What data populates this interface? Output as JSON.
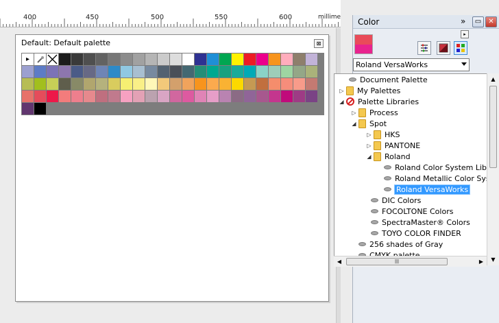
{
  "ruler": {
    "labels": [
      "400",
      "450",
      "500",
      "550",
      "600"
    ],
    "unit": "millimeters"
  },
  "palette_window": {
    "title": "Default: Default palette",
    "close_label": "⊠",
    "special_swatches": [
      "▸",
      "eyedropper",
      "none"
    ],
    "colors": [
      "#1c1c1c",
      "#3a3a3a",
      "#4f4f4f",
      "#626262",
      "#777777",
      "#8c8c8c",
      "#a1a1a1",
      "#b5b5b5",
      "#cbcbcb",
      "#dddddd",
      "#ffffff",
      "#2e3192",
      "#1f8fd6",
      "#00a651",
      "#fff200",
      "#ed1c24",
      "#ec008c",
      "#f7941d",
      "#ffadbc",
      "#8e7f6c",
      "#c2b3d8",
      "#9ca0d0",
      "#5d7cc6",
      "#7c73b7",
      "#8d76ae",
      "#4b5b87",
      "#676985",
      "#6f85b5",
      "#2d8ac8",
      "#90c8e2",
      "#a8bfd1",
      "#778aa0",
      "#536271",
      "#4a4f58",
      "#446872",
      "#248e77",
      "#00a890",
      "#17a17f",
      "#19ab9a",
      "#00aab6",
      "#8ad3c7",
      "#9ecdb8",
      "#9ed5a2",
      "#94a787",
      "#aab27a",
      "#b7bd55",
      "#a2bf1e",
      "#c7cf57",
      "#5f5e4c",
      "#888a67",
      "#b1a66e",
      "#b5b27d",
      "#d9cc5e",
      "#f6ef72",
      "#f9ef87",
      "#fff7b8",
      "#f3c97a",
      "#d3a06c",
      "#f0a35c",
      "#f7941d",
      "#fbaa4e",
      "#f9b233",
      "#fcd900",
      "#c59a53",
      "#c16f3e",
      "#f58d6c",
      "#f68d7b",
      "#f89b8a",
      "#c47a72",
      "#e7726a",
      "#e54c5b",
      "#ed1849",
      "#f37c7c",
      "#ee7f8d",
      "#e6898d",
      "#bf6f7f",
      "#c07a8d",
      "#f6a1c1",
      "#e3a1b5",
      "#bba2af",
      "#d9a5c4",
      "#d1679f",
      "#dd5aa0",
      "#e084b6",
      "#e69ec8",
      "#b983b1",
      "#8b6b85",
      "#906598",
      "#a7588e",
      "#c4368e",
      "#c00b7b",
      "#9e3b85",
      "#7a4385",
      "#61366f",
      "#000000"
    ]
  },
  "docker": {
    "title": "Color",
    "more_label": "»",
    "min_label": "▭",
    "close_label": "✕",
    "tiny_arrow": "▸",
    "colors": {
      "current_top": "#e94b5a",
      "current_bottom": "#e8238e"
    },
    "tool_icons": [
      "sliders-icon",
      "viewer-icon",
      "palette-icon"
    ],
    "dropdown_value": "Roland VersaWorks",
    "tree": [
      {
        "label": "Document Palette",
        "icon": "palette",
        "expander": ""
      },
      {
        "label": "My Palettes",
        "icon": "folder",
        "expander": "▷"
      },
      {
        "label": "Palette Libraries",
        "icon": "no",
        "expander": "◢"
      },
      {
        "label": "Process",
        "icon": "folder",
        "expander": "▷"
      },
      {
        "label": "Spot",
        "icon": "folder",
        "expander": "◢"
      },
      {
        "label": "HKS",
        "icon": "folder",
        "expander": "▷"
      },
      {
        "label": "PANTONE",
        "icon": "folder",
        "expander": "▷"
      },
      {
        "label": "Roland",
        "icon": "folder",
        "expander": "◢"
      },
      {
        "label": "Roland Color System Library",
        "icon": "palette",
        "expander": ""
      },
      {
        "label": "Roland Metallic Color System Library",
        "icon": "palette",
        "expander": ""
      },
      {
        "label": "Roland VersaWorks",
        "icon": "palette",
        "expander": "",
        "selected": true
      },
      {
        "label": "DIC Colors",
        "icon": "palette",
        "expander": ""
      },
      {
        "label": "FOCOLTONE Colors",
        "icon": "palette",
        "expander": ""
      },
      {
        "label": "SpectraMaster® Colors",
        "icon": "palette",
        "expander": ""
      },
      {
        "label": "TOYO COLOR FINDER",
        "icon": "palette",
        "expander": ""
      },
      {
        "label": "256 shades of Gray",
        "icon": "palette",
        "expander": ""
      },
      {
        "label": "CMYK palette",
        "icon": "palette",
        "expander": ""
      }
    ],
    "scroll_up": "▲",
    "scroll_down": "▼",
    "scroll_left": "◀",
    "scroll_right": "▶",
    "thumb_grip": "|||"
  }
}
